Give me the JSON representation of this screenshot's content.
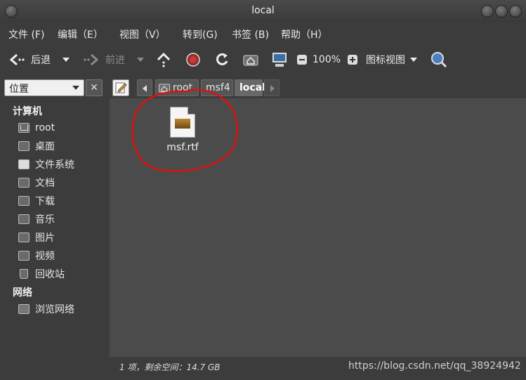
{
  "window": {
    "title": "local"
  },
  "menubar": {
    "items": [
      "文件 (F)",
      "编辑（E）",
      "视图（V）",
      "转到(G)",
      "书签 (B)",
      "帮助（H）"
    ]
  },
  "toolbar": {
    "back_label": "后退",
    "forward_label": "前进",
    "zoom_level": "100%",
    "view_mode_label": "图标视图"
  },
  "sidebar": {
    "selector_label": "位置",
    "sections": [
      {
        "title": "计算机",
        "items": [
          "root",
          "桌面",
          "文件系统",
          "文档",
          "下载",
          "音乐",
          "图片",
          "视频",
          "回收站"
        ]
      },
      {
        "title": "网络",
        "items": [
          "浏览网络"
        ]
      }
    ]
  },
  "location": {
    "crumbs": [
      "root",
      "msf4",
      "local"
    ]
  },
  "content": {
    "files": [
      {
        "name": "msf.rtf"
      }
    ]
  },
  "status": {
    "text": "1 项，剩余空间：14.7 GB"
  },
  "watermark": "https://blog.csdn.net/qq_38924942"
}
